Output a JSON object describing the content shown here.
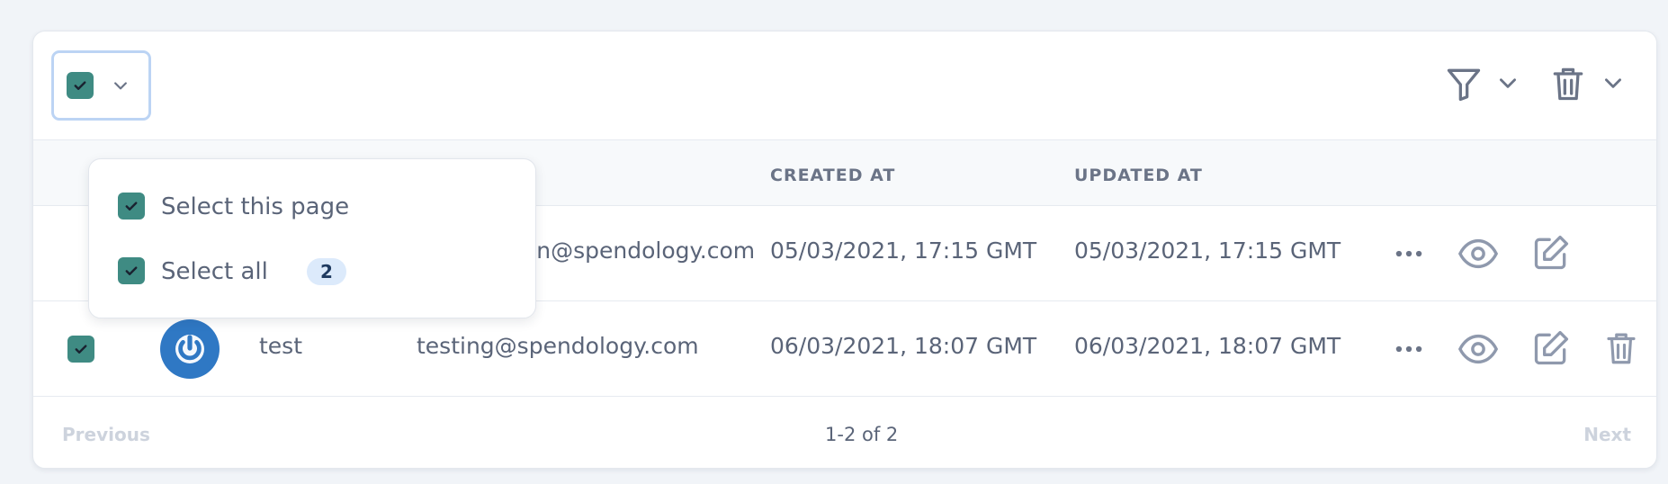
{
  "table": {
    "columns": {
      "created_at": "CREATED AT",
      "updated_at": "UPDATED AT"
    },
    "rows": [
      {
        "email": "on@spendology.com",
        "created": "05/03/2021, 17:15 GMT",
        "updated": "05/03/2021, 17:15 GMT",
        "checked": true
      },
      {
        "name": "test",
        "email": "testing@spendology.com",
        "created": "06/03/2021, 18:07 GMT",
        "updated": "06/03/2021, 18:07 GMT",
        "checked": true
      }
    ]
  },
  "select_menu": {
    "this_page_label": "Select this page",
    "select_all_label": "Select all",
    "select_all_count": "2"
  },
  "pagination": {
    "previous_label": "Previous",
    "info": "1-2 of 2",
    "next_label": "Next"
  },
  "icons": {
    "filter": "filter-icon",
    "trash": "trash-icon",
    "chevron": "chevron-down-icon",
    "more": "more-horizontal-icon",
    "view": "eye-icon",
    "edit": "edit-icon",
    "avatar": "power-icon"
  },
  "colors": {
    "checkbox": "#3f8b83",
    "avatar": "#2f78c4",
    "badge_bg": "#dceafb",
    "focus_ring": "#bcd4f4"
  }
}
